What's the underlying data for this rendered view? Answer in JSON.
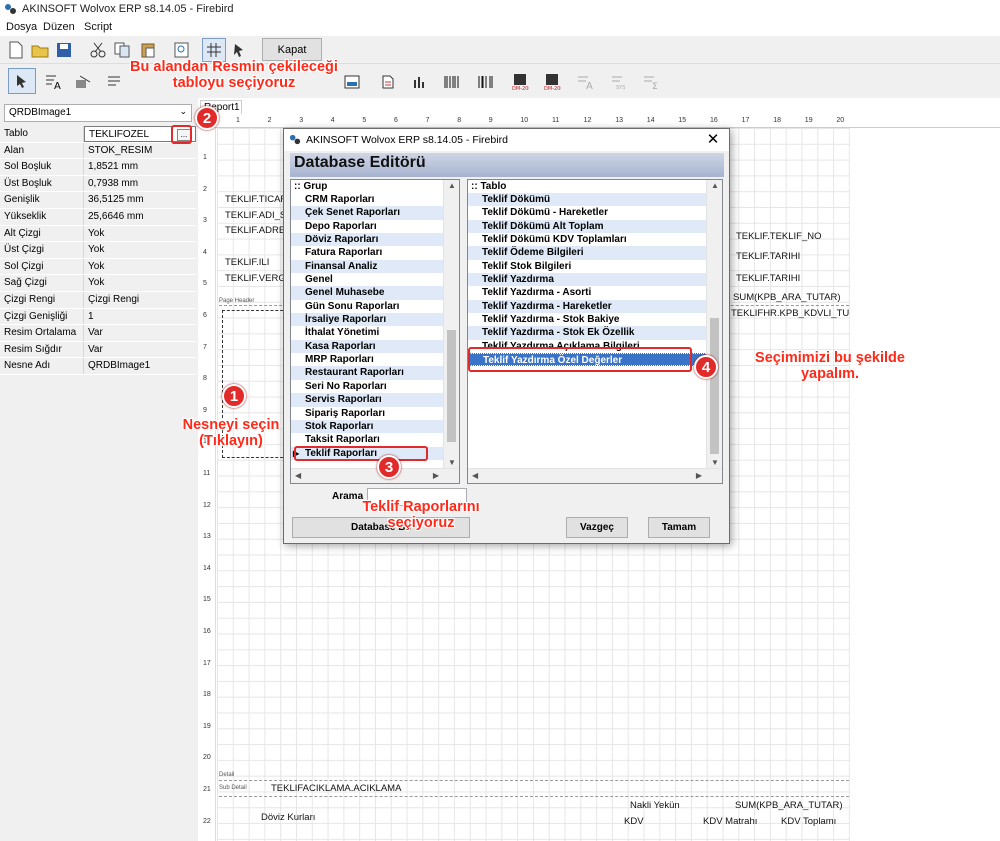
{
  "app": {
    "title": "AKINSOFT Wolvox ERP s8.14.05 - Firebird"
  },
  "menu": [
    "Dosya",
    "Düzen",
    "Script"
  ],
  "toolbar": {
    "close_label": "Kapat"
  },
  "left_panel": {
    "component": "QRDBImage1",
    "properties": [
      {
        "name": "Tablo",
        "value": "TEKLIFOZEL"
      },
      {
        "name": "Alan",
        "value": "STOK_RESIM"
      },
      {
        "name": "Sol Boşluk",
        "value": "1,8521 mm"
      },
      {
        "name": "Üst Boşluk",
        "value": "0,7938 mm"
      },
      {
        "name": "Genişlik",
        "value": "36,5125 mm"
      },
      {
        "name": "Yükseklik",
        "value": "25,6646 mm"
      },
      {
        "name": "Alt Çizgi",
        "value": "Yok"
      },
      {
        "name": "Üst Çizgi",
        "value": "Yok"
      },
      {
        "name": "Sol Çizgi",
        "value": "Yok"
      },
      {
        "name": "Sağ Çizgi",
        "value": "Yok"
      },
      {
        "name": "Çizgi Rengi",
        "value": "Çizgi Rengi"
      },
      {
        "name": "Çizgi Genişliği",
        "value": "1"
      },
      {
        "name": "Resim Ortalama",
        "value": "Var"
      },
      {
        "name": "Resim Sığdır",
        "value": "Var"
      },
      {
        "name": "Nesne Adı",
        "value": "QRDBImage1"
      }
    ]
  },
  "designer": {
    "tab": "Report1",
    "ruler": [
      "1",
      "2",
      "3",
      "4",
      "5",
      "6",
      "7",
      "8",
      "9",
      "10",
      "11",
      "12",
      "13",
      "14",
      "15",
      "16",
      "17",
      "18",
      "19",
      "20"
    ],
    "vruler": [
      "1",
      "2",
      "3",
      "4",
      "5",
      "6",
      "7",
      "8",
      "9",
      "10",
      "11",
      "12",
      "13",
      "14",
      "15",
      "16",
      "17",
      "18",
      "19",
      "20",
      "21",
      "22"
    ],
    "fields": {
      "f1": "TEKLIF.TICAR",
      "f2": "TEKLIF.ADI_SC",
      "f3": "TEKLIF.ADRES",
      "f4": "TEKLIF.ILI",
      "f5": "TEKLIF.VERGI_",
      "f6": "TEKLIF.TEKLIF_NO",
      "f7": "TEKLIF.TARIHI",
      "f8": "TEKLIF.TARIHI",
      "f9": "SUM(KPB_ARA_TUTAR)",
      "f10": "TEKLIFHR.KPB_KDVLI_TU",
      "f11": "TEKLIFACIKLAMA.ACIKLAMA",
      "f12": "Nakli Yekün",
      "f13": "SUM(KPB_ARA_TUTAR)",
      "f14": "Döviz Kurları",
      "f15": "KDV",
      "f16": "KDV Matrahı",
      "f17": "KDV Toplamı"
    },
    "bands": {
      "page_header": "Page Header",
      "detail": "Detail",
      "sub_detail": "Sub Detail"
    }
  },
  "dialog": {
    "title": "AKINSOFT Wolvox ERP s8.14.05 - Firebird",
    "heading": "Database Editörü",
    "group_header": ":: Grup",
    "groups": [
      "CRM Raporları",
      "Çek Senet Raporları",
      "Depo Raporları",
      "Döviz Raporları",
      "Fatura Raporları",
      "Finansal Analiz",
      "Genel",
      "Genel Muhasebe",
      "Gün Sonu Raporları",
      "İrsaliye Raporları",
      "İthalat Yönetimi",
      "Kasa Raporları",
      "MRP Raporları",
      "Restaurant Raporları",
      "Seri No Raporları",
      "Servis Raporları",
      "Sipariş Raporları",
      "Stok Raporları",
      "Taksit Raporları",
      "Teklif Raporları"
    ],
    "table_header": ":: Tablo",
    "tables": [
      "Teklif Dökümü",
      "Teklif Dökümü - Hareketler",
      "Teklif Dökümü Alt Toplam",
      "Teklif Dökümü KDV Toplamları",
      "Teklif Ödeme Bilgileri",
      "Teklif Stok Bilgileri",
      "Teklif Yazdırma",
      "Teklif Yazdırma - Asorti",
      "Teklif Yazdırma - Hareketler",
      "Teklif Yazdırma - Stok Bakiye",
      "Teklif Yazdırma - Stok Ek Özellik",
      "Teklif Yazdırma Açıklama Bilgileri",
      "Teklif Yazdırma Özel Değerler"
    ],
    "search_label": "Arama",
    "search_value": "",
    "db_button": "Database Bil",
    "cancel": "Vazgeç",
    "ok": "Tamam"
  },
  "annotations": {
    "a1_num": "1",
    "a1_text": "Nesneyi seçin (Tıklayın)",
    "a2_num": "2",
    "a2_text": "Bu alandan Resmin çekileceği tabloyu seçiyoruz",
    "a3_num": "3",
    "a3_text": "Teklif Raporlarını seçiyoruz",
    "a4_num": "4",
    "a4_text": "Seçimimizi bu şekilde yapalım.",
    "color": "#e12a2a"
  }
}
